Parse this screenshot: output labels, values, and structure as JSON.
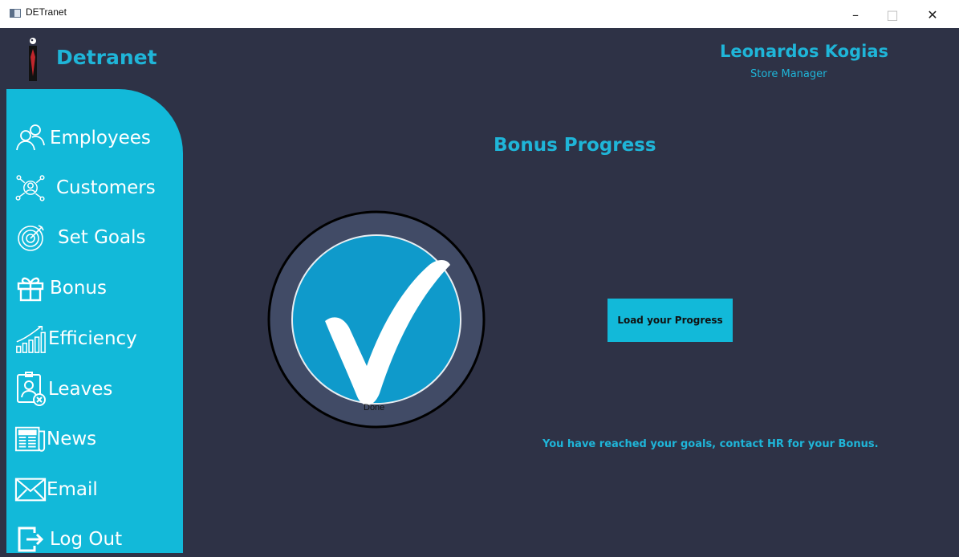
{
  "window": {
    "title": "DETranet",
    "min_glyph": "–",
    "max_glyph": "□",
    "close_glyph": "✕"
  },
  "brand": {
    "name": "Detranet",
    "logo_icon": "tie-figure-icon"
  },
  "user": {
    "name": "Leonardos Kogias",
    "role": "Store Manager"
  },
  "sidebar": {
    "items": [
      {
        "label": "Employees",
        "icon": "users-icon"
      },
      {
        "label": "Customers",
        "icon": "customer-network-icon"
      },
      {
        "label": "Set Goals",
        "icon": "target-icon"
      },
      {
        "label": "Bonus",
        "icon": "gift-icon"
      },
      {
        "label": "Efficiency",
        "icon": "bar-chart-icon"
      },
      {
        "label": "Leaves",
        "icon": "badge-cancel-icon"
      },
      {
        "label": "News",
        "icon": "newspaper-icon"
      },
      {
        "label": "Email",
        "icon": "envelope-icon"
      },
      {
        "label": "Log Out",
        "icon": "logout-icon"
      }
    ]
  },
  "main": {
    "title": "Bonus Progress",
    "progress": {
      "status": "Done",
      "fraction": 1.0
    },
    "load_button": "Load your Progress",
    "message": "You have reached your goals, contact HR for your Bonus."
  },
  "colors": {
    "accent": "#1fb5d8",
    "sidebar": "#12b9d9",
    "background": "#2e3246",
    "dial_ring": "#414b66",
    "dial_fill": "#0f9acb"
  }
}
